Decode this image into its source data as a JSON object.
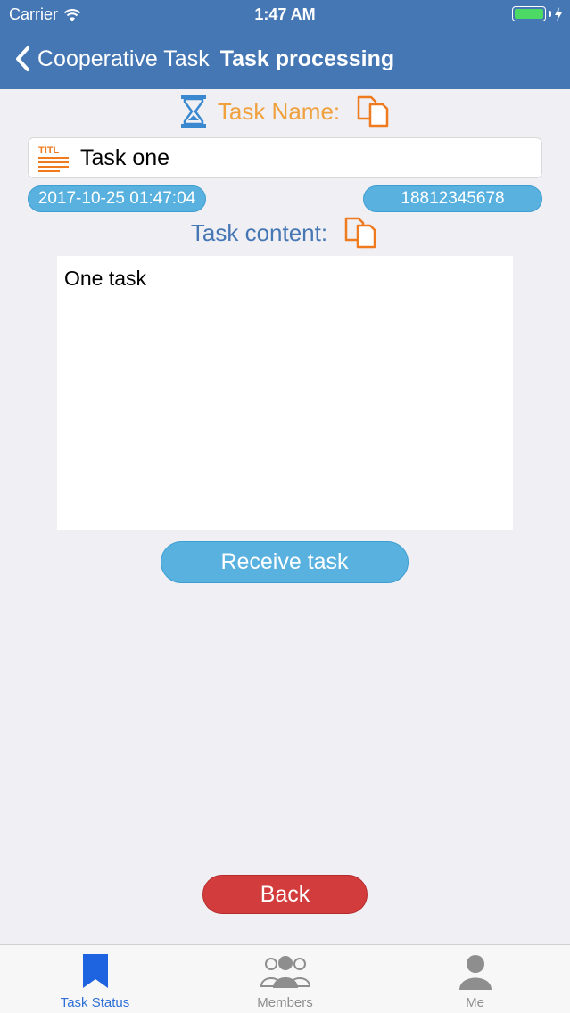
{
  "status_bar": {
    "carrier": "Carrier",
    "time": "1:47 AM"
  },
  "nav": {
    "back_label": "Cooperative Task",
    "title": "Task processing"
  },
  "task": {
    "name_label": "Task Name:",
    "title_value": "Task one",
    "date": "2017-10-25 01:47:04",
    "phone": "18812345678",
    "content_label": "Task content:",
    "content_value": "One task"
  },
  "actions": {
    "receive_label": "Receive task",
    "back_label": "Back"
  },
  "tabbar": {
    "items": [
      {
        "label": "Task Status",
        "icon": "bookmark-icon"
      },
      {
        "label": "Members",
        "icon": "members-icon"
      },
      {
        "label": "Me",
        "icon": "person-icon"
      }
    ]
  },
  "colors": {
    "header": "#4577b5",
    "accent_orange": "#f0a03c",
    "pill_blue": "#59b1df",
    "danger": "#d33c3c",
    "tab_active": "#2e70d8"
  }
}
